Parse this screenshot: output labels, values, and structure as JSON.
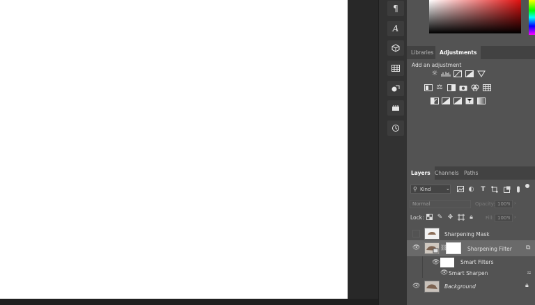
{
  "tools": [
    {
      "icon": "paragraph-icon",
      "glyph": "¶"
    },
    {
      "icon": "character-icon",
      "glyph": "A"
    },
    {
      "icon": "3d-cube-icon",
      "glyph": "⬡"
    },
    {
      "icon": "grid-icon",
      "glyph": "▦"
    },
    {
      "icon": "shapes-icon",
      "glyph": "◭"
    },
    {
      "icon": "actions-icon",
      "glyph": "▭"
    },
    {
      "icon": "history-icon",
      "glyph": "⟲"
    }
  ],
  "adjust_tabs": {
    "libraries": "Libraries",
    "adjustments": "Adjustments"
  },
  "adjustments": {
    "heading": "Add an adjustment"
  },
  "layers_tabs": {
    "layers": "Layers",
    "channels": "Channels",
    "paths": "Paths"
  },
  "layers_toolbar": {
    "filter_kind": "Kind",
    "blend_mode": "Normal",
    "opacity_label": "Opacity:",
    "opacity_value": "100%",
    "lock_label": "Lock:",
    "fill_label": "Fill:",
    "fill_value": "100%"
  },
  "layers": [
    {
      "name": "Sharpening Mask"
    },
    {
      "name": "Sharpening Filter"
    },
    {
      "name": "Smart Filters"
    },
    {
      "name": "Smart Sharpen"
    },
    {
      "name": "Background"
    }
  ],
  "colors": {
    "panel_bg": "#535353",
    "selected_row": "#6a6a6a"
  }
}
